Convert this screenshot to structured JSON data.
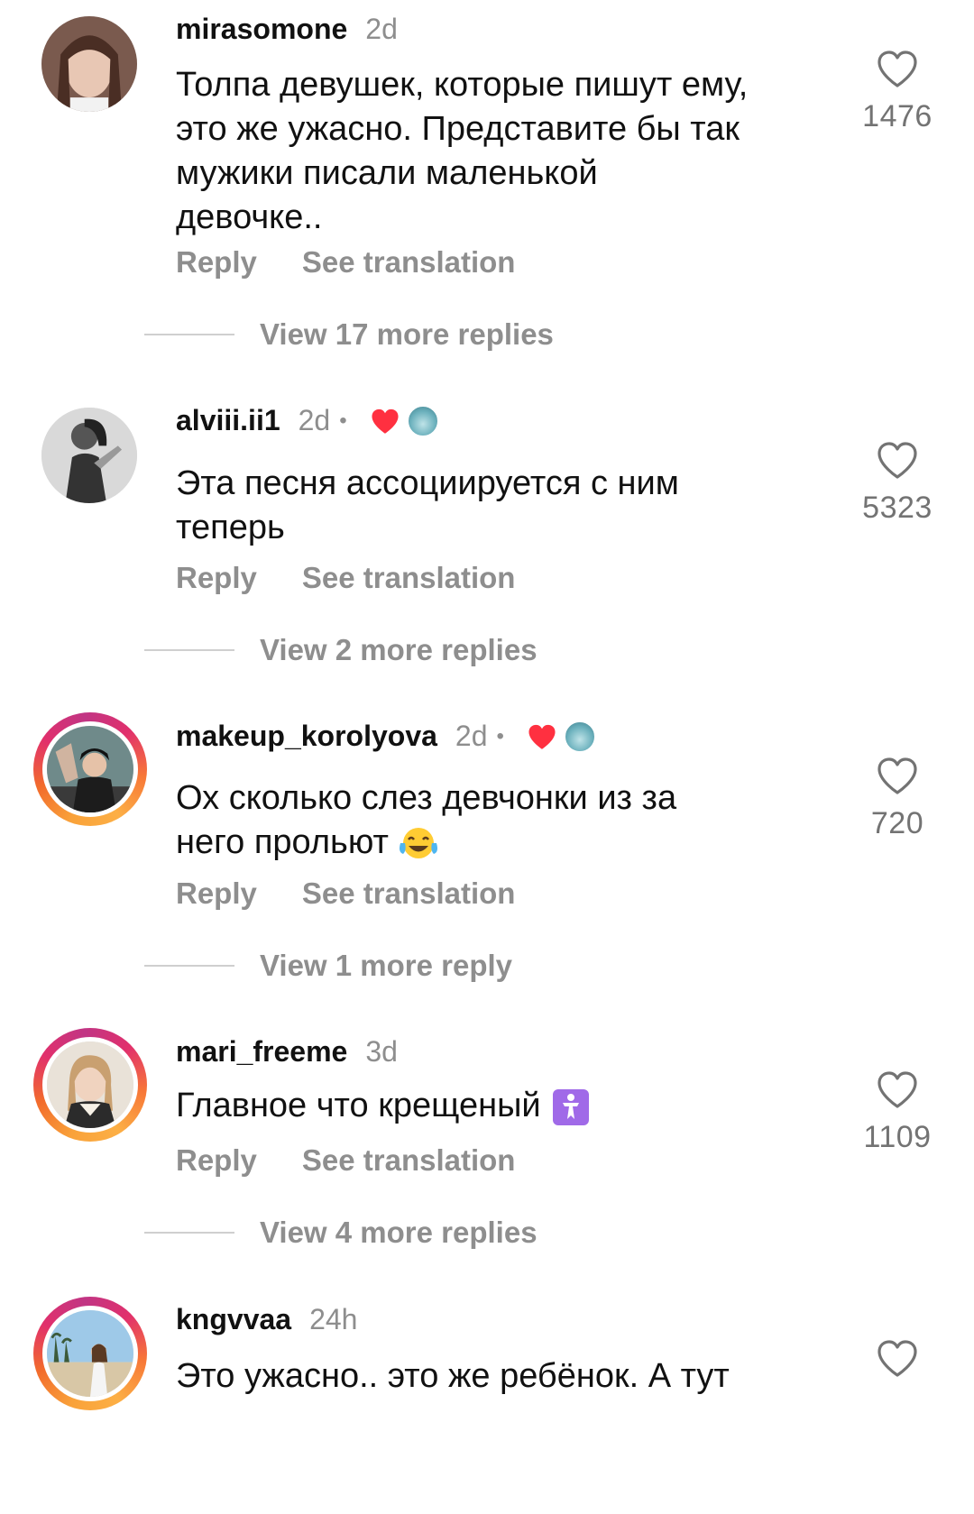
{
  "labels": {
    "reply": "Reply",
    "see_translation": "See translation"
  },
  "comments": [
    {
      "username": "mirasomone",
      "age": "2d",
      "liked_by_creator": false,
      "lines": [
        "Толпа девушек, которые пишут ему,",
        "это же ужасно. Представите бы так",
        "мужики писали маленькой",
        "девочке.."
      ],
      "likes": "1476",
      "more_replies": "View 17 more replies"
    },
    {
      "username": "alviii.ii1",
      "age": "2d",
      "liked_by_creator": true,
      "lines": [
        "Эта песня ассоциируется с ним",
        "теперь"
      ],
      "likes": "5323",
      "more_replies": "View 2 more replies"
    },
    {
      "username": "makeup_korolyova",
      "age": "2d",
      "liked_by_creator": true,
      "lines": [
        "Ох сколько слез девчонки из за",
        "него прольют"
      ],
      "emoji": "face-with-tears-of-joy",
      "likes": "720",
      "more_replies": "View 1 more reply"
    },
    {
      "username": "mari_freeme",
      "age": "3d",
      "liked_by_creator": false,
      "lines": [
        "Главное что крещеный"
      ],
      "emoji": "place-of-worship",
      "likes": "1109",
      "more_replies": "View 4 more replies"
    },
    {
      "username": "kngvvaa",
      "age": "24h",
      "liked_by_creator": false,
      "lines": [
        "Это ужасно.. это же ребёнок. А тут"
      ],
      "likes": "",
      "more_replies": ""
    }
  ],
  "colors": {
    "secondary_text": "#8e8e8e",
    "liked_heart": "#ff3040",
    "story_ring": "#e1306c"
  },
  "icons": {
    "like": "heart-outline-icon",
    "creator_liked": "heart-filled-icon"
  }
}
